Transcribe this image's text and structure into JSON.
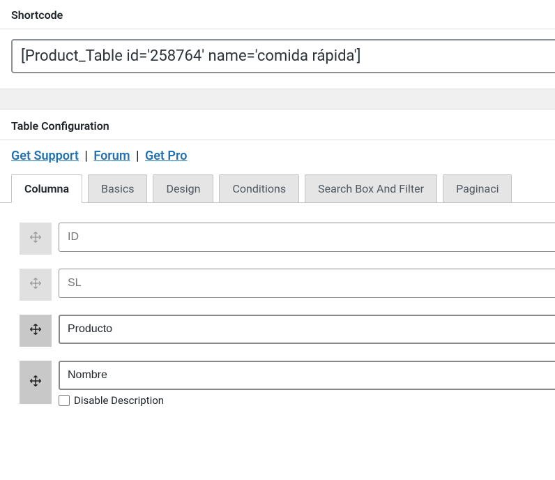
{
  "shortcode": {
    "label": "Shortcode",
    "value": "[Product_Table id='258764' name='comida rápida']"
  },
  "config": {
    "header": "Table Configuration",
    "links": {
      "support": "Get Support",
      "forum": "Forum",
      "pro": "Get Pro"
    },
    "tabs": [
      {
        "label": "Columna",
        "active": true
      },
      {
        "label": "Basics",
        "active": false
      },
      {
        "label": "Design",
        "active": false
      },
      {
        "label": "Conditions",
        "active": false
      },
      {
        "label": "Search Box And Filter",
        "active": false
      },
      {
        "label": "Paginaci",
        "active": false
      }
    ],
    "columns": [
      {
        "placeholder": "ID",
        "value": "",
        "active": false,
        "has_desc_toggle": false
      },
      {
        "placeholder": "SL",
        "value": "",
        "active": false,
        "has_desc_toggle": false
      },
      {
        "placeholder": "",
        "value": "Producto",
        "active": true,
        "has_desc_toggle": false
      },
      {
        "placeholder": "",
        "value": "Nombre",
        "active": true,
        "has_desc_toggle": true
      }
    ],
    "disable_description_label": "Disable Description"
  }
}
